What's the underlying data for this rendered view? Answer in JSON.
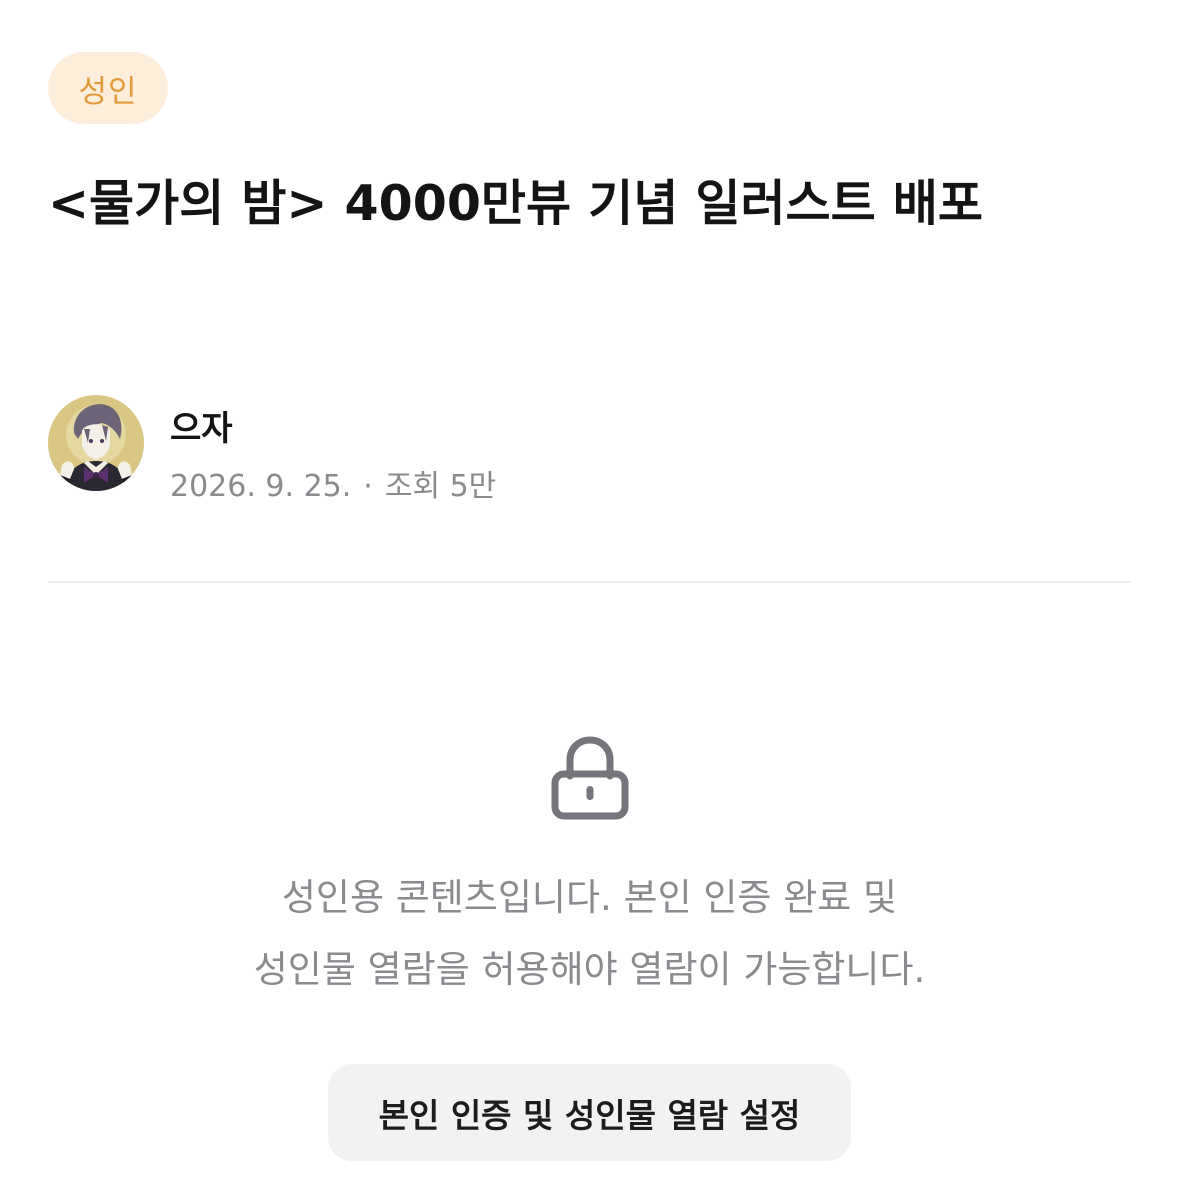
{
  "post": {
    "badge": "성인",
    "title": "<물가의 밤> 4000만뷰 기념 일러스트 배포"
  },
  "author": {
    "name": "으자",
    "date": "2026. 9. 25.",
    "separator": "·",
    "views": "조회 5만",
    "avatar_icon": "character-portrait-avatar"
  },
  "locked": {
    "icon": "lock-icon",
    "message_line1": "성인용 콘텐츠입니다. 본인 인증 완료 및",
    "message_line2": "성인물 열람을 허용해야 열람이 가능합니다.",
    "button_label": "본인 인증 및 성인물 열람 설정"
  },
  "colors": {
    "badge_bg": "#fdeedb",
    "badge_text": "#e39a3b",
    "muted_text": "#8a8a8f",
    "button_bg": "#f2f2f4"
  }
}
